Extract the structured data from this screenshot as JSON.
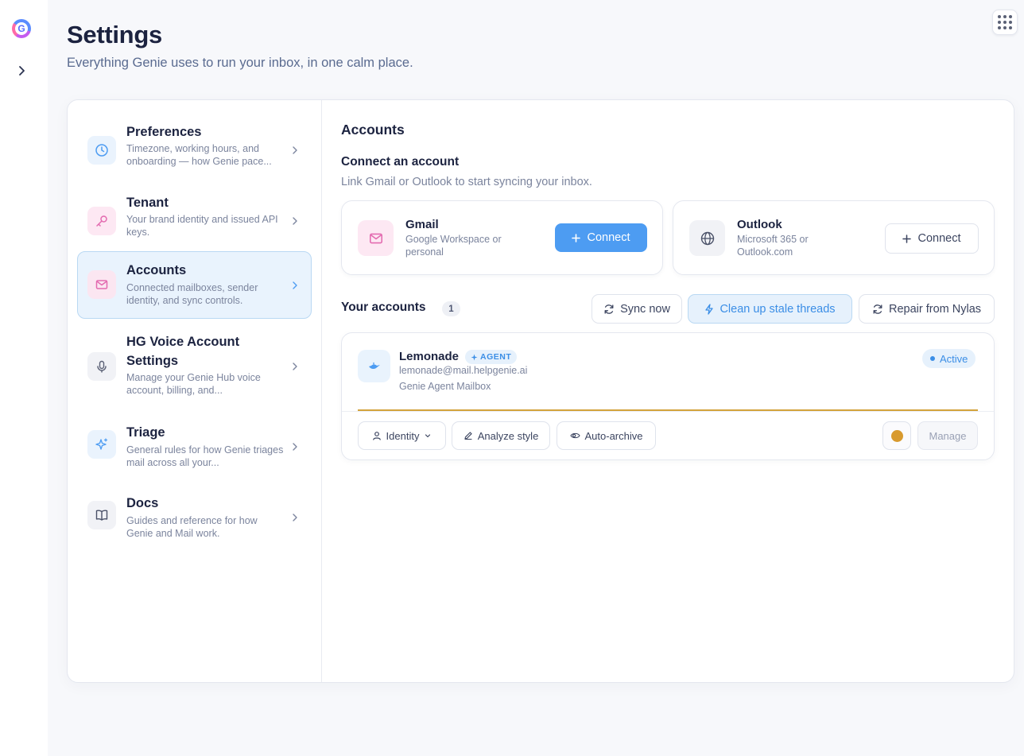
{
  "brand": {
    "logo_letter": "G"
  },
  "header": {
    "title": "Settings",
    "subtitle": "Everything Genie uses to run your inbox, in one calm place."
  },
  "nav": {
    "items": [
      {
        "title": "Preferences",
        "desc": "Timezone, working hours, and onboarding — how Genie pace...",
        "icon": "clock-icon"
      },
      {
        "title": "Tenant",
        "desc": "Your brand identity and issued API keys.",
        "icon": "key-icon"
      },
      {
        "title": "Accounts",
        "desc": "Connected mailboxes, sender identity, and sync controls.",
        "icon": "mail-icon",
        "active": true
      },
      {
        "title": "HG Voice Account Settings",
        "desc": "Manage your Genie Hub voice account, billing, and...",
        "icon": "microphone-icon"
      },
      {
        "title": "Triage",
        "desc": "General rules for how Genie triages mail across all your...",
        "icon": "sparkles-icon"
      },
      {
        "title": "Docs",
        "desc": "Guides and reference for how Genie and Mail work.",
        "icon": "book-icon"
      }
    ]
  },
  "content": {
    "title": "Accounts",
    "connect": {
      "title": "Connect an account",
      "desc": "Link Gmail or Outlook to start syncing your inbox.",
      "providers": [
        {
          "name": "Gmail",
          "desc": "Google Workspace or personal",
          "button": "Connect",
          "icon": "mail-icon"
        },
        {
          "name": "Outlook",
          "desc": "Microsoft 365 or Outlook.com",
          "button": "Connect",
          "icon": "globe-icon"
        }
      ]
    },
    "your_accounts": {
      "title": "Your accounts",
      "count": "1",
      "actions": {
        "sync": "Sync now",
        "cleanup": "Clean up stale threads",
        "repair": "Repair from Nylas"
      },
      "account": {
        "name": "Lemonade",
        "badge": "AGENT",
        "email": "lemonade@mail.helpgenie.ai",
        "type": "Genie Agent Mailbox",
        "status": "Active",
        "chips": {
          "identity": "Identity",
          "analyze": "Analyze style",
          "archive": "Auto-archive"
        },
        "manage": "Manage"
      }
    }
  },
  "colors": {
    "accent": "#4d9cf2",
    "active_bg": "#e9f3fd",
    "gold": "#d89a2e",
    "pink_icon": "#e36bb0"
  }
}
